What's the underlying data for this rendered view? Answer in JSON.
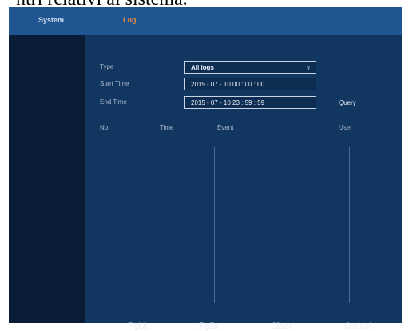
{
  "caption": "ntri relativi al sistema.",
  "tabs": {
    "system": "System",
    "log": "Log"
  },
  "form": {
    "type_label": "Type",
    "type_value": "All logs",
    "start_label": "Start Time",
    "start_value": "2015 - 07 - 10    00 : 00 : 00",
    "end_label": "End Time",
    "end_value": "2015 - 07 - 10    23 : 59 : 59",
    "query": "Query"
  },
  "table": {
    "columns": [
      "No.",
      "Time",
      "Event",
      "User"
    ],
    "rows": []
  },
  "buttons": {
    "pgup": "PgUp",
    "pgdn": "PgDn",
    "clear": "Clear",
    "cancel": "Cancel"
  },
  "colors": {
    "topbar": "#1f5590",
    "panel": "#113660",
    "active_tab": "#e88a3c"
  }
}
